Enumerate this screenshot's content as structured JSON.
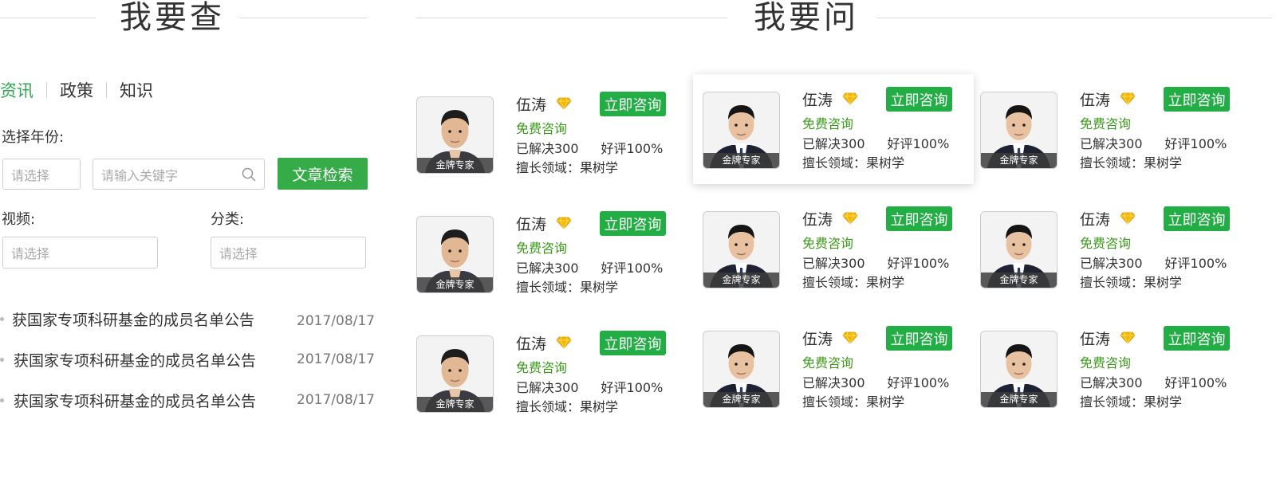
{
  "left": {
    "title": "我要查",
    "tabs": [
      {
        "label": "资讯",
        "active": true
      },
      {
        "label": "政策",
        "active": false
      },
      {
        "label": "知识",
        "active": false
      }
    ],
    "year_label": "选择年份:",
    "year_placeholder": "请选择",
    "keyword_placeholder": "请输入关键字",
    "search_button": "文章检索",
    "video_label": "视频:",
    "video_placeholder": "请选择",
    "category_label": "分类:",
    "category_placeholder": "请选择",
    "news": [
      {
        "title": "获国家专项科研基金的成员名单公告",
        "date": "2017/08/17"
      },
      {
        "title": "获国家专项科研基金的成员名单公告",
        "date": "2017/08/17"
      },
      {
        "title": "获国家专项科研基金的成员名单公告",
        "date": "2017/08/17"
      }
    ]
  },
  "right": {
    "title": "我要问",
    "experts": [
      {
        "name": "伍涛",
        "badge": "金牌专家",
        "button": "立即咨询",
        "free": "免费咨询",
        "solved": "已解决300",
        "rating": "好评100%",
        "field": "擅长领域：果树学"
      },
      {
        "name": "伍涛",
        "badge": "金牌专家",
        "button": "立即咨询",
        "free": "免费咨询",
        "solved": "已解决300",
        "rating": "好评100%",
        "field": "擅长领域：果树学"
      },
      {
        "name": "伍涛",
        "badge": "金牌专家",
        "button": "立即咨询",
        "free": "免费咨询",
        "solved": "已解决300",
        "rating": "好评100%",
        "field": "擅长领域：果树学"
      },
      {
        "name": "伍涛",
        "badge": "金牌专家",
        "button": "立即咨询",
        "free": "免费咨询",
        "solved": "已解决300",
        "rating": "好评100%",
        "field": "擅长领域：果树学"
      },
      {
        "name": "伍涛",
        "badge": "金牌专家",
        "button": "立即咨询",
        "free": "免费咨询",
        "solved": "已解决300",
        "rating": "好评100%",
        "field": "擅长领域：果树学"
      },
      {
        "name": "伍涛",
        "badge": "金牌专家",
        "button": "立即咨询",
        "free": "免费咨询",
        "solved": "已解决300",
        "rating": "好评100%",
        "field": "擅长领域：果树学"
      },
      {
        "name": "伍涛",
        "badge": "金牌专家",
        "button": "立即咨询",
        "free": "免费咨询",
        "solved": "已解决300",
        "rating": "好评100%",
        "field": "擅长领域：果树学"
      },
      {
        "name": "伍涛",
        "badge": "金牌专家",
        "button": "立即咨询",
        "free": "免费咨询",
        "solved": "已解决300",
        "rating": "好评100%",
        "field": "擅长领域：果树学"
      },
      {
        "name": "伍涛",
        "badge": "金牌专家",
        "button": "立即咨询",
        "free": "免费咨询",
        "solved": "已解决300",
        "rating": "好评100%",
        "field": "擅长领域：果树学"
      }
    ]
  },
  "colors": {
    "accent": "#2fa84f",
    "button": "#22ad45",
    "free_text": "#3b9a1a",
    "gem": "#f5b800"
  },
  "icons": {
    "search": "search-icon",
    "gem": "diamond-icon"
  }
}
